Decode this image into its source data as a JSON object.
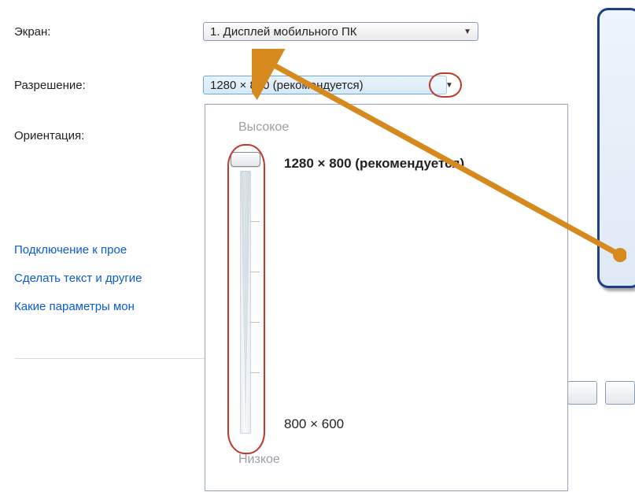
{
  "labels": {
    "screen": "Экран:",
    "resolution": "Разрешение:",
    "orientation": "Ориентация:"
  },
  "dropdowns": {
    "screen_value": "1. Дисплей мобильного ПК",
    "resolution_value": "1280 × 800 (рекомендуется)"
  },
  "flyout": {
    "high": "Высокое",
    "low": "Низкое",
    "current": "1280 × 800 (рекомендуется)",
    "min": "800 × 600"
  },
  "links": {
    "projector": "Подключение к прое",
    "text_size": "Сделать текст и другие",
    "monitor_params": "Какие параметры мон"
  },
  "colors": {
    "highlight_ring": "#c0392b",
    "callout_border": "#1d3f88",
    "guide_arrow": "#d68a1e"
  }
}
